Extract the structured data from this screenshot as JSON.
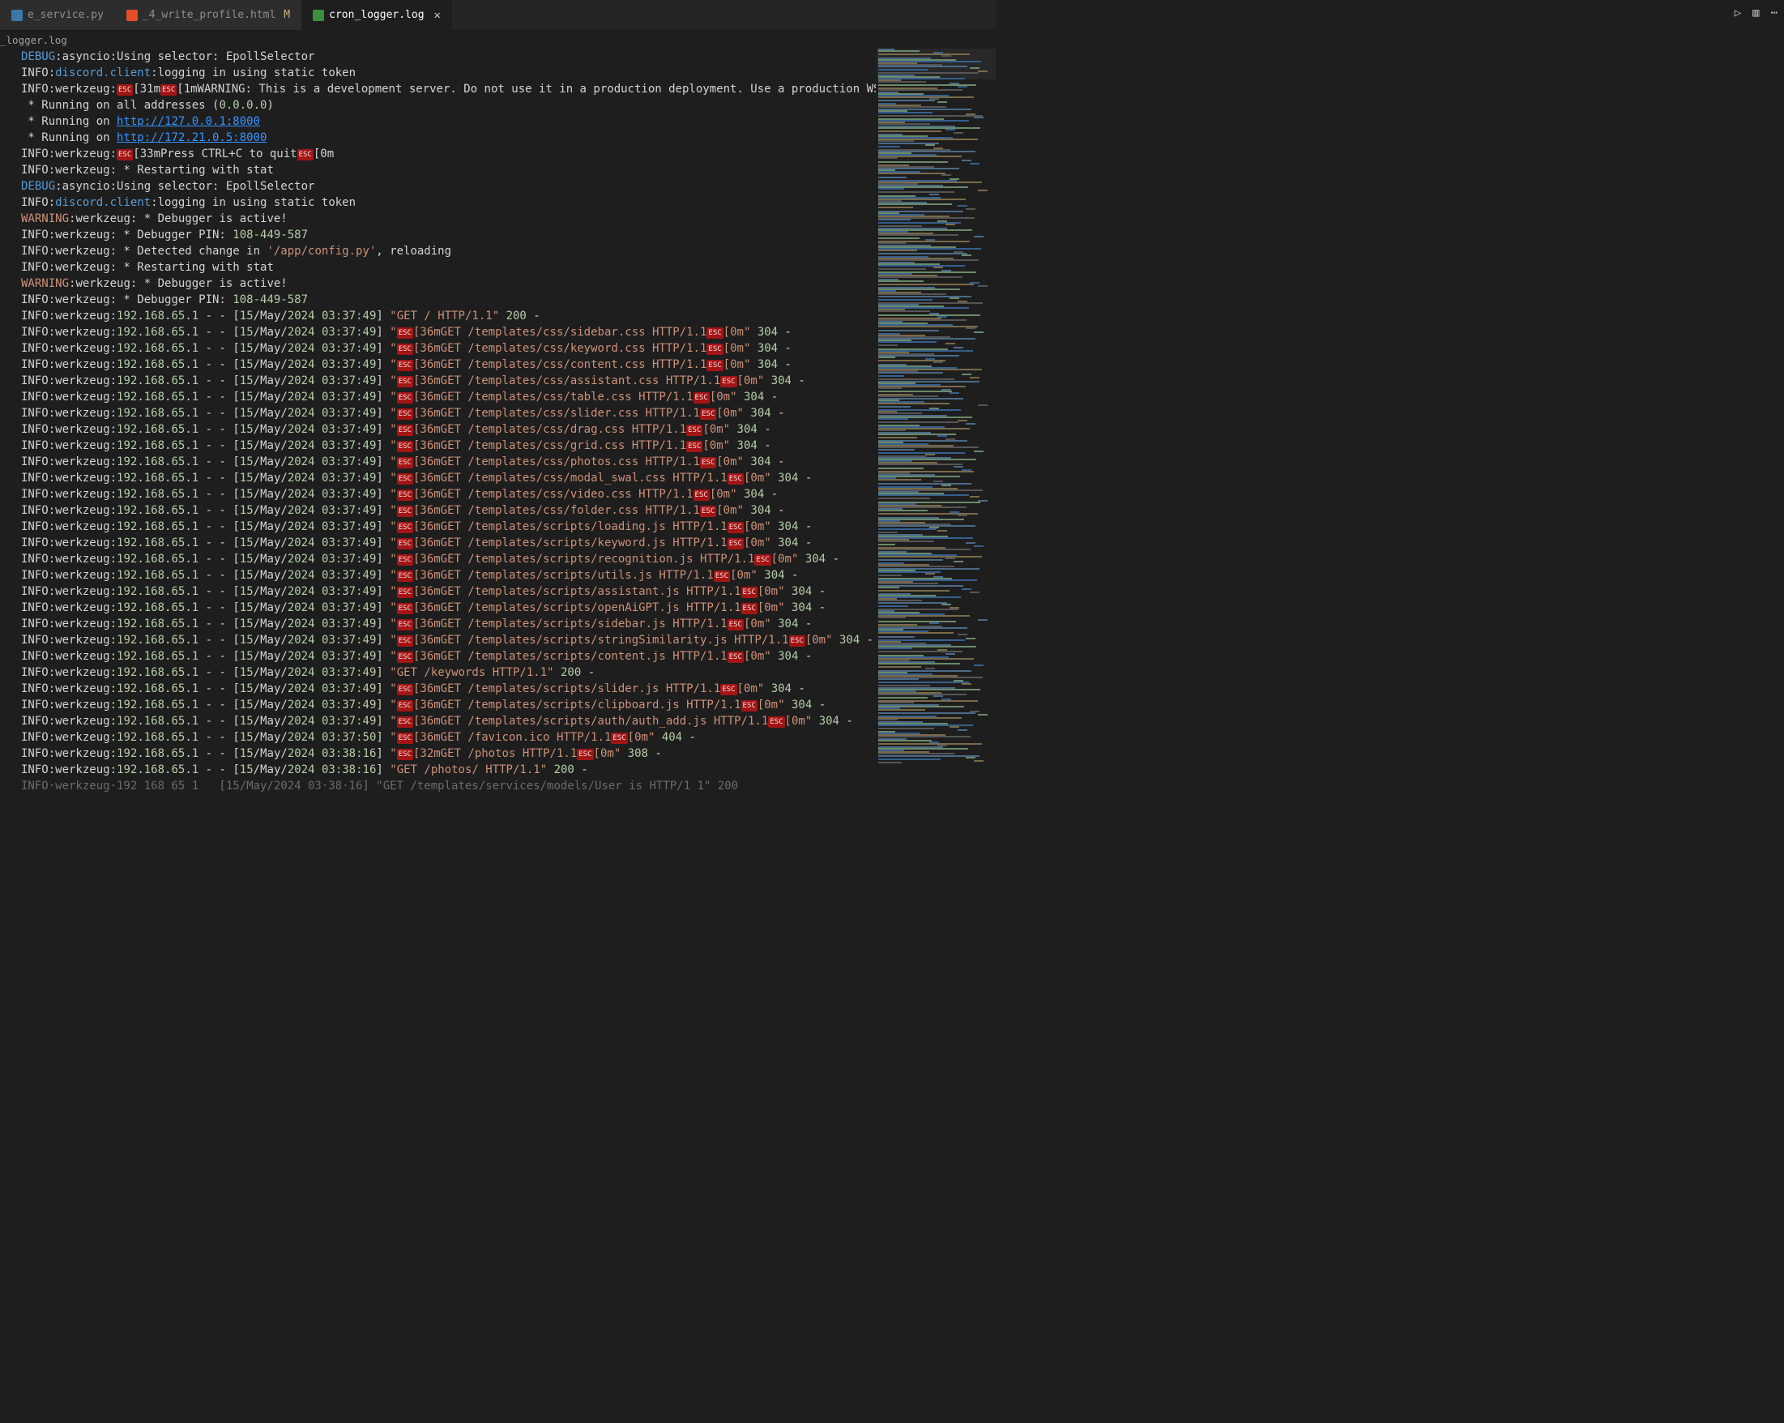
{
  "tabs": [
    {
      "label": "e_service.py",
      "active": false,
      "modified": ""
    },
    {
      "label": "_4_write_profile.html",
      "active": false,
      "modified": "M"
    },
    {
      "label": "cron_logger.log",
      "active": true,
      "modified": ""
    }
  ],
  "breadcrumb": "_logger.log",
  "icons": {
    "run": "▷",
    "split": "▥",
    "more": "⋯",
    "close": "✕",
    "esc": "ESC"
  },
  "log": {
    "ip": [
      "192",
      ".",
      "168",
      ".",
      "65",
      ".",
      "1"
    ],
    "date_open": "[",
    "date_day": "15",
    "date_slash": "/",
    "date_mon": "May",
    "date_year": "2024",
    "date_space": " ",
    "date_close": "]",
    "time1": "03:37:49",
    "time2": "03:37:50",
    "time3": "03:38:16",
    "dash_sep": " - - ",
    "after_date_space": " ",
    "quote": "\"",
    "esc_open": "[",
    "esc36": "36m",
    "esc32": "32m",
    "esc33": "33m",
    "esc31": "31m",
    "esc1m": "1m",
    "esc0m": "0m",
    "trailing_dash": " -",
    "pin": "108-449-587",
    "addr_all": "0.0.0.0",
    "addr1": "http://127.0.0.1:8000",
    "addr2": "http://172.21.0.5:8000",
    "cfg": "'/app/config.py'",
    "reloading": ", reloading",
    "status200": "200",
    "status304": "304",
    "status308": "308",
    "status404": "404",
    "lines_intro": [
      "DEBUG:asyncio:Using selector: EpollSelector",
      "INFO:discord.client:logging in using static token"
    ],
    "werk_warn": "WARNING: This is a development server. Do not use it in a production deployment. Use a production WSGI serv",
    "running_all": " * Running on all addresses (",
    "running_on": " * Running on ",
    "press_ctrlc": "Press CTRL+C to quit",
    "restarting": "INFO:werkzeug: * Restarting with stat",
    "debug_sel": "DEBUG:asyncio:Using selector: EpollSelector",
    "login2": "INFO:discord.client:logging in using static token",
    "dbg_active": "WARNING:werkzeug: * Debugger is active!",
    "pin_label": "INFO:werkzeug: * Debugger PIN: ",
    "detected": "INFO:werkzeug: * Detected change in ",
    "get_root": "GET / HTTP/1.1",
    "get_keywords": "GET /keywords HTTP/1.1",
    "get_photos_plain": "GET /photos/ HTTP/1.1",
    "get_photos_esc": "GET /photos HTTP/1.1",
    "requests": [
      {
        "path": "GET /templates/css/sidebar.css HTTP/1.1",
        "status": "304",
        "t": "03:37:49"
      },
      {
        "path": "GET /templates/css/keyword.css HTTP/1.1",
        "status": "304",
        "t": "03:37:49"
      },
      {
        "path": "GET /templates/css/content.css HTTP/1.1",
        "status": "304",
        "t": "03:37:49"
      },
      {
        "path": "GET /templates/css/assistant.css HTTP/1.1",
        "status": "304",
        "t": "03:37:49"
      },
      {
        "path": "GET /templates/css/table.css HTTP/1.1",
        "status": "304",
        "t": "03:37:49"
      },
      {
        "path": "GET /templates/css/slider.css HTTP/1.1",
        "status": "304",
        "t": "03:37:49"
      },
      {
        "path": "GET /templates/css/drag.css HTTP/1.1",
        "status": "304",
        "t": "03:37:49"
      },
      {
        "path": "GET /templates/css/grid.css HTTP/1.1",
        "status": "304",
        "t": "03:37:49"
      },
      {
        "path": "GET /templates/css/photos.css HTTP/1.1",
        "status": "304",
        "t": "03:37:49"
      },
      {
        "path": "GET /templates/css/modal_swal.css HTTP/1.1",
        "status": "304",
        "t": "03:37:49"
      },
      {
        "path": "GET /templates/css/video.css HTTP/1.1",
        "status": "304",
        "t": "03:37:49"
      },
      {
        "path": "GET /templates/css/folder.css HTTP/1.1",
        "status": "304",
        "t": "03:37:49"
      },
      {
        "path": "GET /templates/scripts/loading.js HTTP/1.1",
        "status": "304",
        "t": "03:37:49"
      },
      {
        "path": "GET /templates/scripts/keyword.js HTTP/1.1",
        "status": "304",
        "t": "03:37:49"
      },
      {
        "path": "GET /templates/scripts/recognition.js HTTP/1.1",
        "status": "304",
        "t": "03:37:49"
      },
      {
        "path": "GET /templates/scripts/utils.js HTTP/1.1",
        "status": "304",
        "t": "03:37:49"
      },
      {
        "path": "GET /templates/scripts/assistant.js HTTP/1.1",
        "status": "304",
        "t": "03:37:49"
      },
      {
        "path": "GET /templates/scripts/openAiGPT.js HTTP/1.1",
        "status": "304",
        "t": "03:37:49"
      },
      {
        "path": "GET /templates/scripts/sidebar.js HTTP/1.1",
        "status": "304",
        "t": "03:37:49"
      },
      {
        "path": "GET /templates/scripts/stringSimilarity.js HTTP/1.1",
        "status": "304",
        "t": "03:37:49"
      },
      {
        "path": "GET /templates/scripts/content.js HTTP/1.1",
        "status": "304",
        "t": "03:37:49"
      }
    ],
    "requests2": [
      {
        "path": "GET /templates/scripts/slider.js HTTP/1.1",
        "status": "304",
        "t": "03:37:49"
      },
      {
        "path": "GET /templates/scripts/clipboard.js HTTP/1.1",
        "status": "304",
        "t": "03:37:49"
      },
      {
        "path": "GET /templates/scripts/auth/auth_add.js HTTP/1.1",
        "status": "304",
        "t": "03:37:49"
      },
      {
        "path": "GET /favicon.ico HTTP/1.1",
        "status": "404",
        "t": "03:37:50"
      }
    ],
    "bottom_dim": "INFO·werkzeug·192 168 65 1   [15/May/2024 03·38·16] \"GET /templates/services/models/User is HTTP/1 1\" 200"
  }
}
